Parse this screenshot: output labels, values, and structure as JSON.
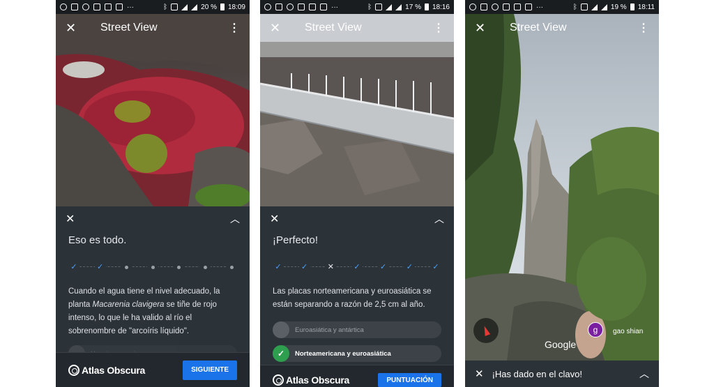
{
  "screens": [
    {
      "status": {
        "battery": "20 %",
        "time": "18:09"
      },
      "topbar": {
        "title": "Street View"
      },
      "panel": {
        "title": "Eso es todo.",
        "steps": [
          "check",
          "check",
          "dot",
          "dot",
          "dot",
          "dot",
          "dot"
        ],
        "text_before": "Cuando el agua tiene el nivel adecuado, la planta ",
        "text_italic": "Macarenia clavigera",
        "text_after": " se tiñe de rojo intenso, lo que le ha valido al río el sobrenombre de \"arcoíris líquido\".",
        "faded_option": "Un microorganismo",
        "logo": "Atlas Obscura",
        "button": "SIGUIENTE"
      }
    },
    {
      "status": {
        "battery": "17 %",
        "time": "18:16"
      },
      "topbar": {
        "title": "Street View"
      },
      "panel": {
        "title": "¡Perfecto!",
        "steps": [
          "check",
          "check",
          "wrong",
          "check",
          "check",
          "check",
          "check"
        ],
        "text": "Las placas norteamericana y euroasiática se están separando a razón de 2,5 cm al año.",
        "options": [
          {
            "label": "Euroasiática y antártica",
            "state": "incorrect"
          },
          {
            "label": "Norteamericana y euroasiática",
            "state": "correct"
          }
        ],
        "logo": "Atlas Obscura",
        "button": "PUNTUACIÓN"
      }
    },
    {
      "status": {
        "battery": "19 %",
        "time": "18:11"
      },
      "topbar": {
        "title": "Street View"
      },
      "map": {
        "google": "Google",
        "avatar_initial": "g",
        "author": "gao shian"
      },
      "bottombar": {
        "message": "¡Has dado en el clavo!"
      }
    }
  ],
  "colors": {
    "accent": "#1a73e8",
    "panel": "#2b3238",
    "check": "#4aa3ff",
    "correct": "#2e9e4f",
    "avatar": "#7b1fa2"
  },
  "icons": [
    "close-icon",
    "more-vert-icon",
    "chevron-up-icon",
    "check-icon",
    "compass-icon",
    "atlas-obscura-logo-icon"
  ]
}
